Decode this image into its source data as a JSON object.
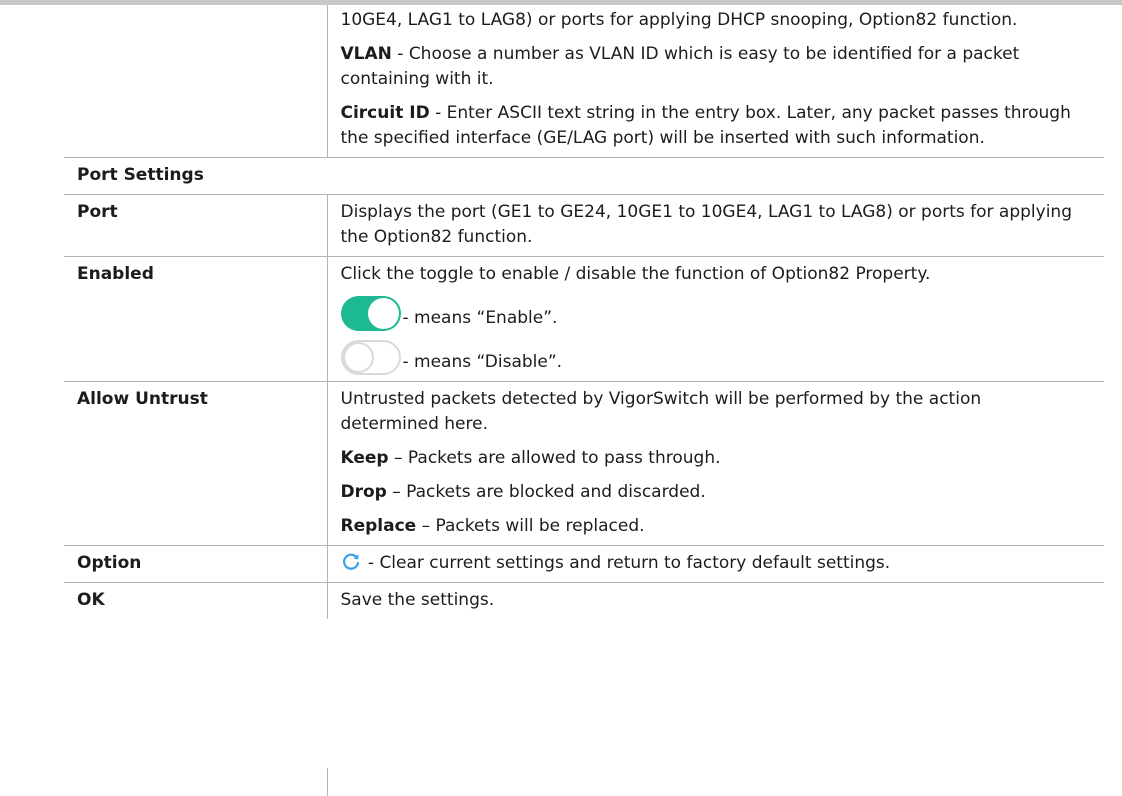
{
  "intro": {
    "interface_tail": "10GE4, LAG1 to LAG8) or ports for applying DHCP snooping, Option82 function.",
    "vlan_term": "VLAN",
    "vlan_text": " - Choose a number as VLAN ID which is easy to be identified for a packet containing with it.",
    "circuit_term": "Circuit ID",
    "circuit_text": " - Enter ASCII text string in the entry box. Later, any packet passes through the specified interface (GE/LAG port) will be inserted with such information."
  },
  "port_settings": {
    "heading": "Port Settings",
    "port": {
      "label": "Port",
      "text": "Displays the port (GE1 to GE24, 10GE1 to 10GE4, LAG1 to LAG8) or ports for applying the Option82 function."
    },
    "enabled": {
      "label": "Enabled",
      "text": "Click the toggle to enable / disable the function of Option82 Property.",
      "enable_text": " - means “Enable”.",
      "disable_text": " - means “Disable”.",
      "on_color": "#1cb992",
      "off_color": "#d9d9d9"
    },
    "allow_untrust": {
      "label": "Allow Untrust",
      "text": "Untrusted packets detected by VigorSwitch will be performed by the action determined here.",
      "keep_term": "Keep",
      "keep_text": " – Packets are allowed to pass through.",
      "drop_term": "Drop",
      "drop_text": " – Packets are blocked and discarded.",
      "replace_term": "Replace",
      "replace_text": " – Packets will be replaced."
    },
    "option": {
      "label": "Option",
      "icon": "refresh-icon",
      "icon_color": "#3aa0e8",
      "text": " - Clear current settings and return to factory default settings."
    },
    "ok": {
      "label": "OK",
      "text": "Save the settings."
    }
  }
}
